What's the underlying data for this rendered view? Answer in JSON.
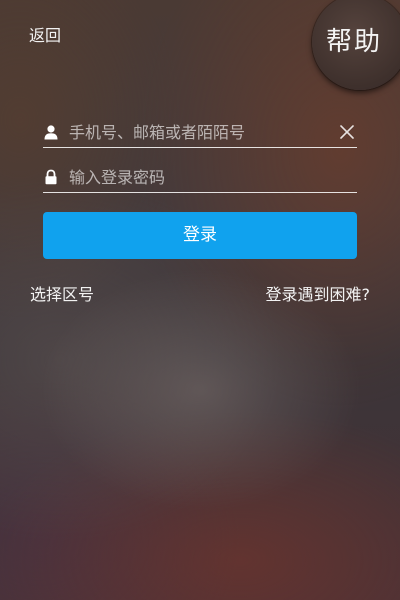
{
  "header": {
    "back_label": "返回",
    "help_label": "帮助"
  },
  "form": {
    "phone": {
      "placeholder": "手机号、邮箱或者陌陌号",
      "value": "",
      "icon": "user-icon"
    },
    "password": {
      "placeholder": "输入登录密码",
      "value": "",
      "icon": "lock-icon"
    },
    "clear_icon": "clear-icon",
    "login_label": "登录"
  },
  "footer": {
    "region_label": "选择区号",
    "trouble_label": "登录遇到困难?"
  },
  "colors": {
    "accent": "#10a2ee",
    "text": "#ffffff"
  }
}
